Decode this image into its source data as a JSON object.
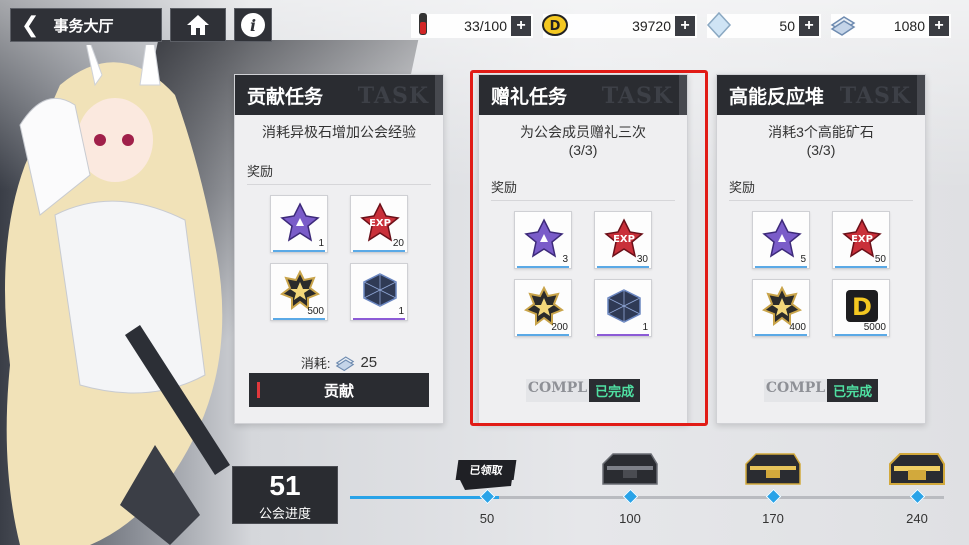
{
  "header": {
    "title": "事务大厅",
    "back_icon": "chevron-left-icon",
    "home_icon": "home-icon",
    "info_icon": "info-icon",
    "info_glyph": "i"
  },
  "resources": [
    {
      "icon": "red-vial-icon",
      "value": "33/100",
      "plus": "+"
    },
    {
      "icon": "d-coin-icon",
      "value": "39720",
      "plus": "+"
    },
    {
      "icon": "crystal-icon",
      "value": "50",
      "plus": "+"
    },
    {
      "icon": "voucher-icon",
      "value": "1080",
      "plus": "+"
    }
  ],
  "cards": [
    {
      "title": "贡献任务",
      "watermark": "TASK",
      "desc_line1": "消耗异极石增加公会经验",
      "desc_line2": "",
      "reward_label": "奖励",
      "rewards": [
        {
          "icon": "purple-star-icon",
          "qty": "1"
        },
        {
          "icon": "exp-star-icon",
          "qty": "20"
        },
        {
          "icon": "gold-star-icon",
          "qty": "500"
        },
        {
          "icon": "dark-cube-icon",
          "qty": "1"
        }
      ],
      "cost_label": "消耗:",
      "cost_amount": "25",
      "button_label": "贡献"
    },
    {
      "title": "赠礼任务",
      "watermark": "TASK",
      "desc_line1": "为公会成员赠礼三次",
      "desc_line2": "(3/3)",
      "reward_label": "奖励",
      "rewards": [
        {
          "icon": "purple-star-icon",
          "qty": "3"
        },
        {
          "icon": "exp-star-icon",
          "qty": "30"
        },
        {
          "icon": "gold-star-icon",
          "qty": "200"
        },
        {
          "icon": "dark-cube-icon",
          "qty": "1"
        }
      ],
      "complete_en": "COMPL",
      "complete_cn": "已完成"
    },
    {
      "title": "高能反应堆",
      "watermark": "TASK",
      "desc_line1": "消耗3个高能矿石",
      "desc_line2": "(3/3)",
      "reward_label": "奖励",
      "rewards": [
        {
          "icon": "purple-star-icon",
          "qty": "5"
        },
        {
          "icon": "exp-star-icon",
          "qty": "50"
        },
        {
          "icon": "gold-star-icon",
          "qty": "400"
        },
        {
          "icon": "d-coin-icon",
          "qty": "5000"
        }
      ],
      "complete_en": "COMPL",
      "complete_cn": "已完成"
    }
  ],
  "progress": {
    "value": "51",
    "label": "公会进度",
    "milestones": [
      "50",
      "100",
      "170",
      "240"
    ],
    "claimed_tag": "已领取",
    "fill_fraction": 0.25
  },
  "colors": {
    "accent_blue": "#29a3e8",
    "complete_green": "#4fe0a2",
    "highlight_red": "#e11b16",
    "panel_dark": "#2a2c31"
  }
}
